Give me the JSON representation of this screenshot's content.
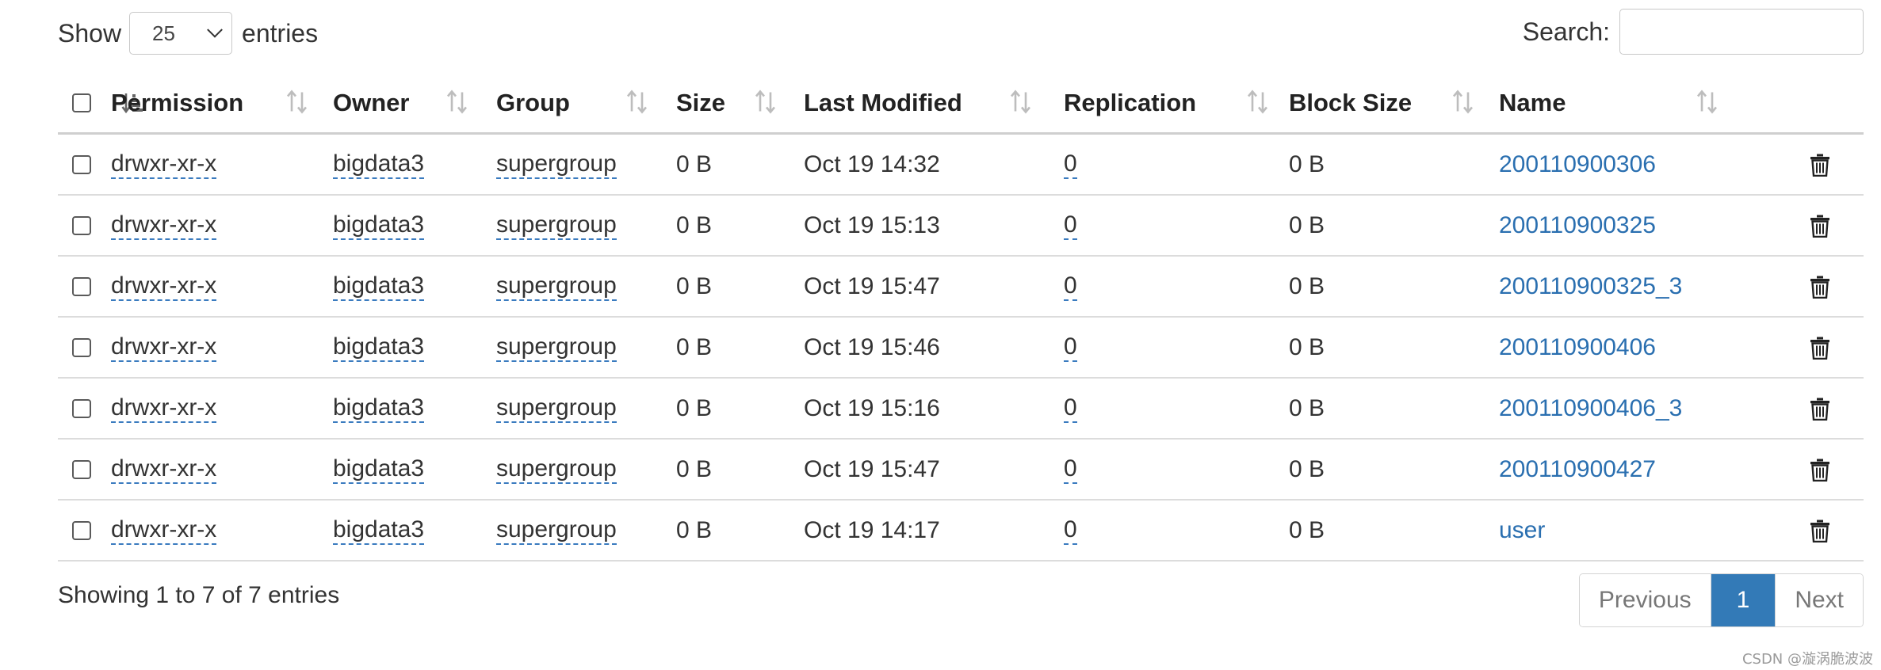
{
  "length_control": {
    "show_label": "Show",
    "selected": "25",
    "entries_label": "entries"
  },
  "search": {
    "label": "Search:",
    "value": "",
    "placeholder": ""
  },
  "table": {
    "columns": [
      "Permission",
      "Owner",
      "Group",
      "Size",
      "Last Modified",
      "Replication",
      "Block Size",
      "Name"
    ],
    "rows": [
      {
        "permission": "drwxr-xr-x",
        "owner": "bigdata3",
        "group": "supergroup",
        "size": "0 B",
        "last_modified": "Oct 19 14:32",
        "replication": "0",
        "block_size": "0 B",
        "name": "200110900306"
      },
      {
        "permission": "drwxr-xr-x",
        "owner": "bigdata3",
        "group": "supergroup",
        "size": "0 B",
        "last_modified": "Oct 19 15:13",
        "replication": "0",
        "block_size": "0 B",
        "name": "200110900325"
      },
      {
        "permission": "drwxr-xr-x",
        "owner": "bigdata3",
        "group": "supergroup",
        "size": "0 B",
        "last_modified": "Oct 19 15:47",
        "replication": "0",
        "block_size": "0 B",
        "name": "200110900325_3"
      },
      {
        "permission": "drwxr-xr-x",
        "owner": "bigdata3",
        "group": "supergroup",
        "size": "0 B",
        "last_modified": "Oct 19 15:46",
        "replication": "0",
        "block_size": "0 B",
        "name": "200110900406"
      },
      {
        "permission": "drwxr-xr-x",
        "owner": "bigdata3",
        "group": "supergroup",
        "size": "0 B",
        "last_modified": "Oct 19 15:16",
        "replication": "0",
        "block_size": "0 B",
        "name": "200110900406_3"
      },
      {
        "permission": "drwxr-xr-x",
        "owner": "bigdata3",
        "group": "supergroup",
        "size": "0 B",
        "last_modified": "Oct 19 15:47",
        "replication": "0",
        "block_size": "0 B",
        "name": "200110900427"
      },
      {
        "permission": "drwxr-xr-x",
        "owner": "bigdata3",
        "group": "supergroup",
        "size": "0 B",
        "last_modified": "Oct 19 14:17",
        "replication": "0",
        "block_size": "0 B",
        "name": "user"
      }
    ]
  },
  "footer": {
    "info": "Showing 1 to 7 of 7 entries",
    "previous_label": "Previous",
    "current_page": "1",
    "next_label": "Next"
  },
  "watermark": "CSDN @漩涡脆波波",
  "colors": {
    "link": "#2a6fb0",
    "pager_active": "#337ab7",
    "dotted_underline": "#3a7bbf"
  },
  "icons": {
    "sort_active": "sort-amount-down-icon",
    "sort": "sort-arrows-icon",
    "delete": "trash-icon"
  }
}
